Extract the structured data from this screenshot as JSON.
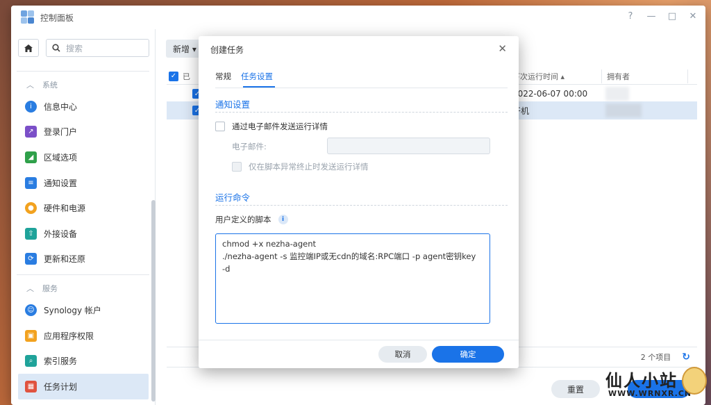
{
  "window": {
    "title": "控制面板",
    "controls": [
      "?",
      "—",
      "□",
      "✕"
    ]
  },
  "sidebar": {
    "search_placeholder": "搜索",
    "groups": [
      {
        "label": "系统",
        "items": [
          {
            "label": "信息中心",
            "icon": "info-icon",
            "color": "#2a7de1"
          },
          {
            "label": "登录门户",
            "icon": "login-portal-icon",
            "color": "#7b4fc8"
          },
          {
            "label": "区域选项",
            "icon": "region-icon",
            "color": "#2fa04a"
          },
          {
            "label": "通知设置",
            "icon": "notification-icon",
            "color": "#2a7de1"
          },
          {
            "label": "硬件和电源",
            "icon": "bulb-icon",
            "color": "#f2a21f"
          },
          {
            "label": "外接设备",
            "icon": "external-device-icon",
            "color": "#1fa39a"
          },
          {
            "label": "更新和还原",
            "icon": "update-icon",
            "color": "#2a7de1"
          }
        ]
      },
      {
        "label": "服务",
        "items": [
          {
            "label": "Synology 帐户",
            "icon": "account-icon",
            "color": "#2a7de1"
          },
          {
            "label": "应用程序权限",
            "icon": "lock-icon",
            "color": "#f2a21f"
          },
          {
            "label": "索引服务",
            "icon": "index-icon",
            "color": "#1fa39a"
          },
          {
            "label": "任务计划",
            "icon": "calendar-icon",
            "color": "#e0533f",
            "active": true
          }
        ]
      }
    ]
  },
  "main": {
    "new_button": "新增 ▾",
    "columns": {
      "status_prefix": "已",
      "next_run": "下次运行时间 ▴",
      "owner": "拥有者"
    },
    "rows": [
      {
        "next_run": "2022-06-07 00:00"
      },
      {
        "next_run": "开机"
      }
    ],
    "item_count": "2 个项目",
    "reset": "重置"
  },
  "dialog": {
    "title": "创建任务",
    "tabs": [
      {
        "label": "常规"
      },
      {
        "label": "任务设置",
        "active": true
      }
    ],
    "notify": {
      "section": "通知设置",
      "send_email": "通过电子邮件发送运行详情",
      "email_label": "电子邮件:",
      "only_abnormal": "仅在脚本异常终止时发送运行详情"
    },
    "run": {
      "section": "运行命令",
      "script_label": "用户定义的脚本",
      "script": "chmod +x nezha-agent\n./nezha-agent -s 监控端IP或无cdn的域名:RPC端口 -p agent密钥key\n-d"
    },
    "cancel": "取消",
    "ok": "确定"
  },
  "watermark": {
    "line1": "仙人小站",
    "line2": "WWW.WRNXR.CN"
  }
}
